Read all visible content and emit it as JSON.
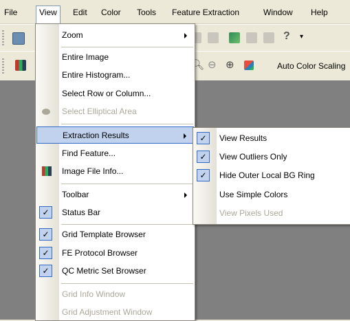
{
  "menubar": {
    "items": [
      "File",
      "View",
      "Edit",
      "Color",
      "Tools",
      "Feature Extraction",
      "Window",
      "Help"
    ]
  },
  "toolbar": {
    "color_scaling_label": "Auto Color Scaling"
  },
  "view_menu": {
    "items": [
      {
        "label": "Zoom",
        "submenu": true
      },
      {
        "label": "Entire Image"
      },
      {
        "label": "Entire Histogram..."
      },
      {
        "label": "Select Row or Column..."
      },
      {
        "label": "Select Elliptical Area",
        "disabled": true
      },
      {
        "label": "Extraction Results",
        "submenu": true,
        "highlighted": true
      },
      {
        "label": "Find Feature..."
      },
      {
        "label": "Image File Info..."
      },
      {
        "label": "Toolbar",
        "submenu": true
      },
      {
        "label": "Status Bar",
        "checked": true
      },
      {
        "label": "Grid Template Browser",
        "checked": true
      },
      {
        "label": "FE Protocol Browser",
        "checked": true
      },
      {
        "label": "QC Metric Set Browser",
        "checked": true
      },
      {
        "label": "Grid Info Window",
        "disabled": true
      },
      {
        "label": "Grid Adjustment Window",
        "disabled": true
      }
    ]
  },
  "extraction_submenu": {
    "items": [
      {
        "label": "View Results",
        "checked": true
      },
      {
        "label": "View Outliers Only",
        "checked": true
      },
      {
        "label": "Hide Outer Local BG Ring",
        "checked": true
      },
      {
        "label": "Use Simple Colors"
      },
      {
        "label": "View Pixels Used",
        "disabled": true
      }
    ]
  },
  "check_glyph": "✓",
  "colors": {
    "highlight_bg": "#c1d2ee",
    "highlight_border": "#316ac5",
    "workspace": "#808080",
    "chrome": "#ece9d8"
  }
}
